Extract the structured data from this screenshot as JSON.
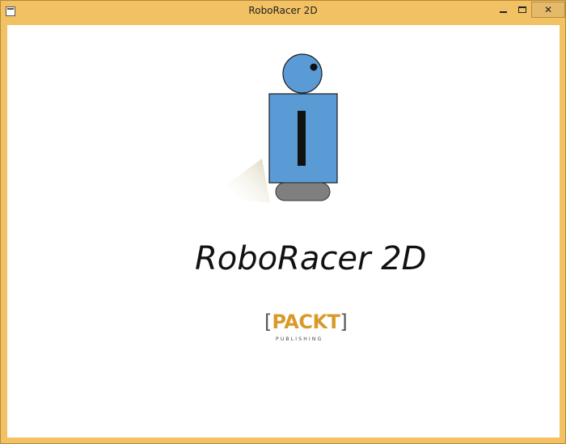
{
  "window": {
    "title": "RoboRacer 2D",
    "close_glyph": "✕"
  },
  "colors": {
    "title_bar": "#f1c164",
    "robot_body": "#5b9bd5",
    "robot_base": "#7f7f7f",
    "packt_orange": "#d99a2b"
  },
  "icons": [
    "app-icon",
    "minimize-icon",
    "maximize-icon",
    "close-icon",
    "robot-sprite"
  ],
  "content": {
    "game_title": "RoboRacer 2D",
    "logo": {
      "left_bracket": "[",
      "word": "PACKT",
      "right_bracket": "]",
      "tagline": "PUBLISHING"
    }
  }
}
